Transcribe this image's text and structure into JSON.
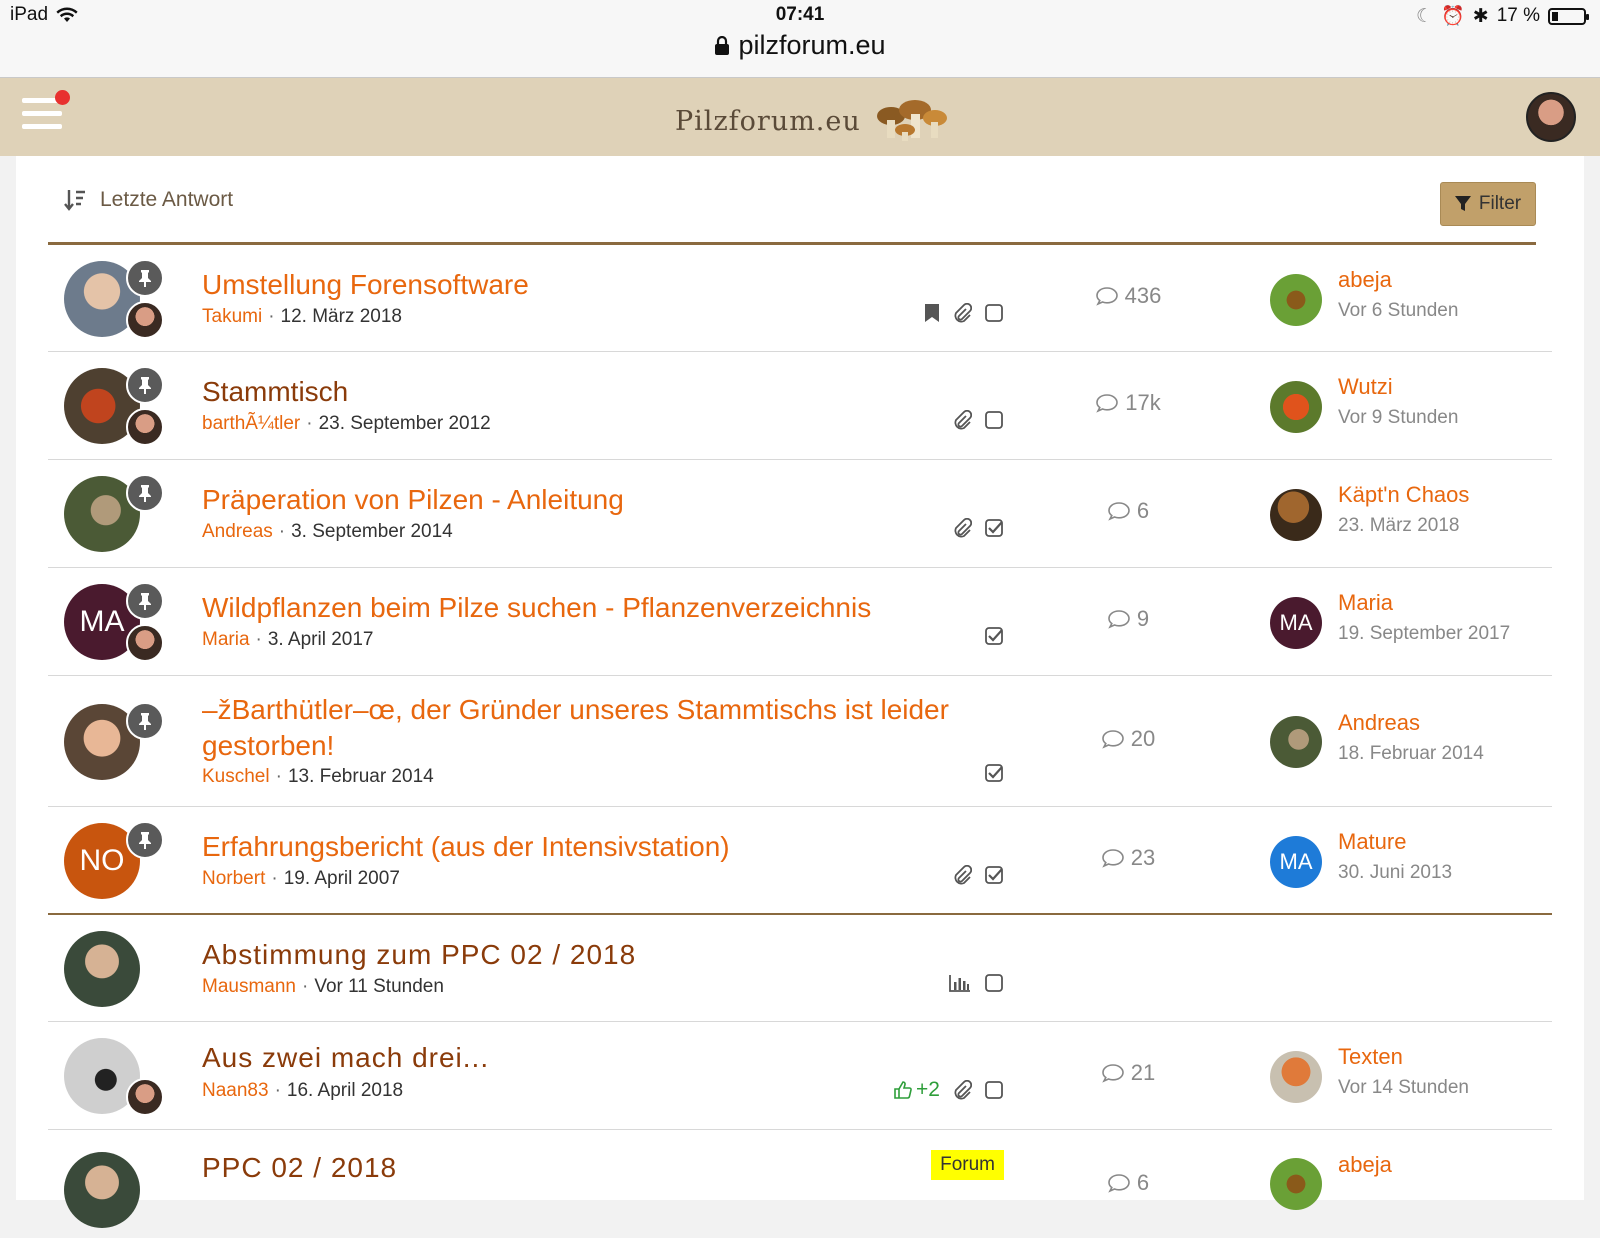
{
  "status": {
    "device": "iPad",
    "time": "07:41",
    "battery": "17 %",
    "url": "pilzforum.eu"
  },
  "site": {
    "logo_text": "Pilzforum.eu"
  },
  "toolbar": {
    "sort_label": "Letzte Antwort",
    "filter_label": "Filter"
  },
  "threads": [
    {
      "title": "Umstellung Forensoftware",
      "author": "Takumi",
      "date": "12. März 2018",
      "replies": "436",
      "last_author": "abeja",
      "last_time": "Vor 6 Stunden"
    },
    {
      "title": "Stammtisch",
      "author": "barthÃ¼tler",
      "date": "23. September 2012",
      "replies": "17k",
      "last_author": "Wutzi",
      "last_time": "Vor 9 Stunden"
    },
    {
      "title": "Präperation von Pilzen - Anleitung",
      "author": "Andreas",
      "date": "3. September 2014",
      "replies": "6",
      "last_author": "Käpt'n Chaos",
      "last_time": "23. März 2018"
    },
    {
      "title": "Wildpflanzen beim Pilze suchen - Pflanzenverzeichnis",
      "author": "Maria",
      "date": "3. April 2017",
      "replies": "9",
      "last_author": "Maria",
      "last_time": "19. September 2017",
      "initials": "MA",
      "last_initials": "MA"
    },
    {
      "title": "–žBarthütler–œ, der Gründer unseres Stammtischs ist leider gestorben!",
      "author": "Kuschel",
      "date": "13. Februar 2014",
      "replies": "20",
      "last_author": "Andreas",
      "last_time": "18. Februar 2014"
    },
    {
      "title": "Erfahrungsbericht (aus der Intensivstation)",
      "author": "Norbert",
      "date": "19. April 2007",
      "replies": "23",
      "last_author": "Mature",
      "last_time": "30. Juni 2013",
      "initials": "NO",
      "last_initials": "MA"
    },
    {
      "title": "Abstimmung zum PPC 02 / 2018",
      "author": "Mausmann",
      "date": "Vor 11 Stunden"
    },
    {
      "title": "Aus zwei mach drei...",
      "author": "Naan83",
      "date": "16. April 2018",
      "likes": "+2",
      "replies": "21",
      "last_author": "Texten",
      "last_time": "Vor 14 Stunden"
    },
    {
      "title": "PPC 02 / 2018",
      "badge": "Forum",
      "replies": "6",
      "last_author": "abeja"
    }
  ],
  "colors": {
    "accent": "#e8670e",
    "title_read": "#8a3b0a",
    "header_bg": "#dfd2b8",
    "filter_bg": "#c1a06a"
  }
}
